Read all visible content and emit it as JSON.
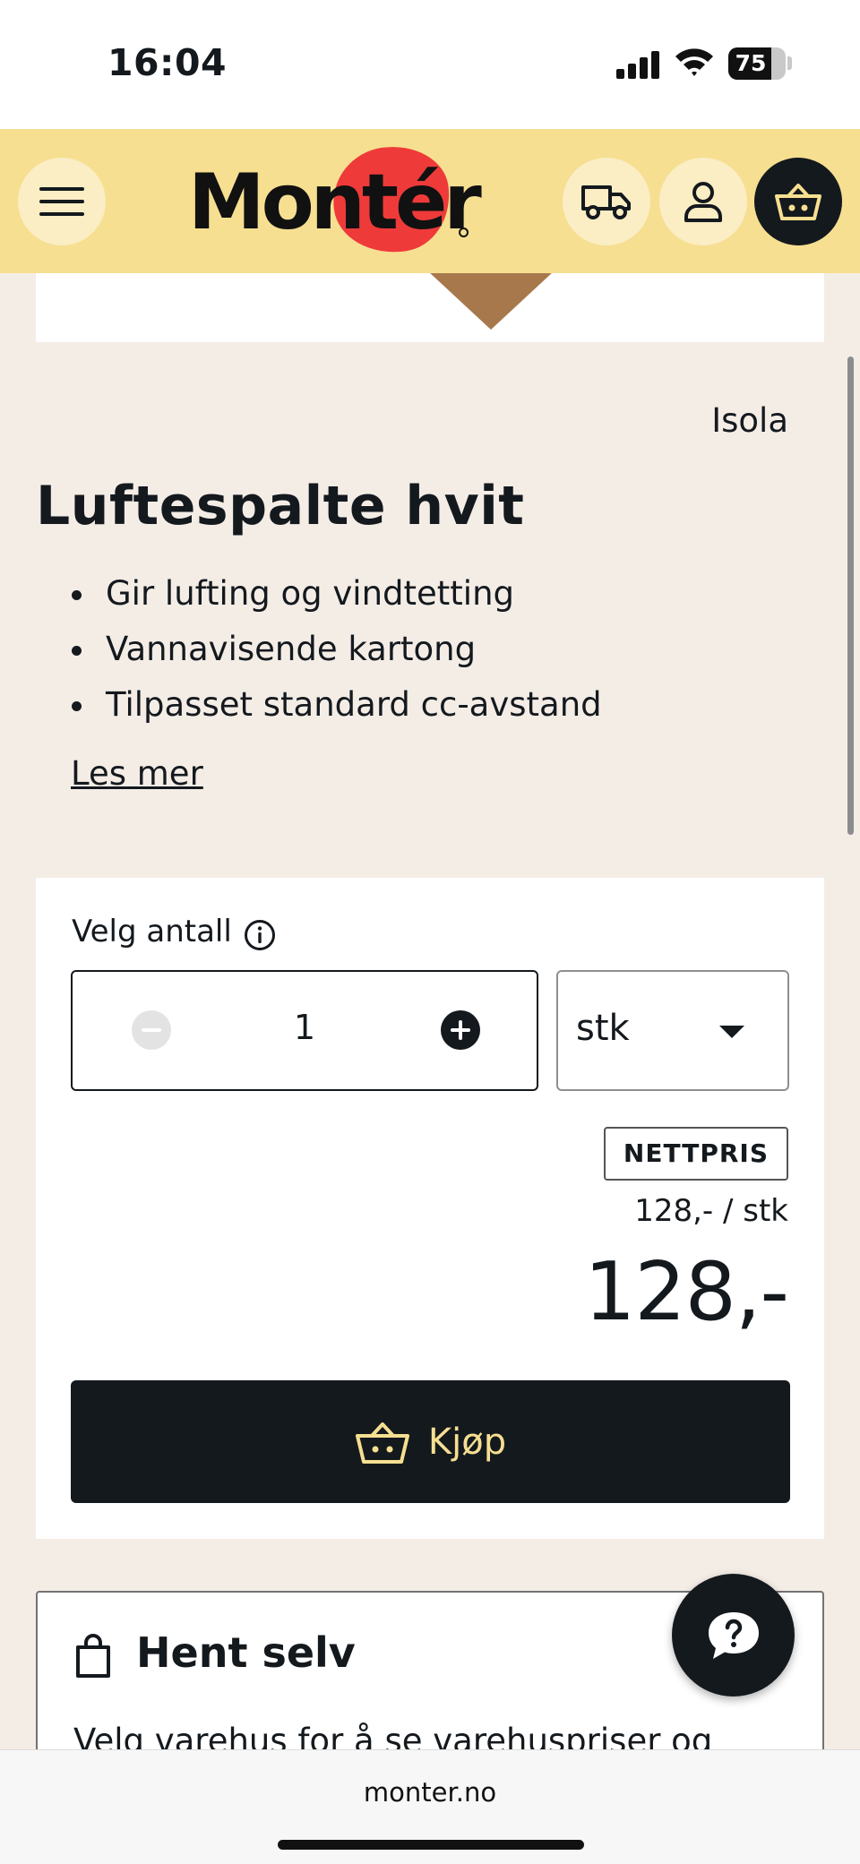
{
  "status_bar": {
    "time": "16:04",
    "battery": "75",
    "battery_level": 0.75
  },
  "header": {
    "logo_text": "Montér",
    "icons": [
      "menu-icon",
      "truck-icon",
      "user-icon",
      "basket-icon"
    ],
    "brand_yellow": "#f6df91",
    "brand_red": "#ef3a3a"
  },
  "product": {
    "brand": "Isola",
    "title": "Luftespalte hvit",
    "bullets": [
      "Gir lufting og vindtetting",
      "Vannavisende kartong",
      "Tilpasset standard cc-avstand"
    ],
    "read_more": "Les mer"
  },
  "purchase": {
    "quantity_label": "Velg antall",
    "quantity": "1",
    "unit": "stk",
    "badge": "NETTPRIS",
    "unit_price": "128,- / stk",
    "total_price": "128,-",
    "buy_label": "Kjøp"
  },
  "pickup": {
    "title": "Hent selv",
    "text": "Velg varehus for å se varehuspriser og"
  },
  "browser": {
    "url": "monter.no"
  }
}
